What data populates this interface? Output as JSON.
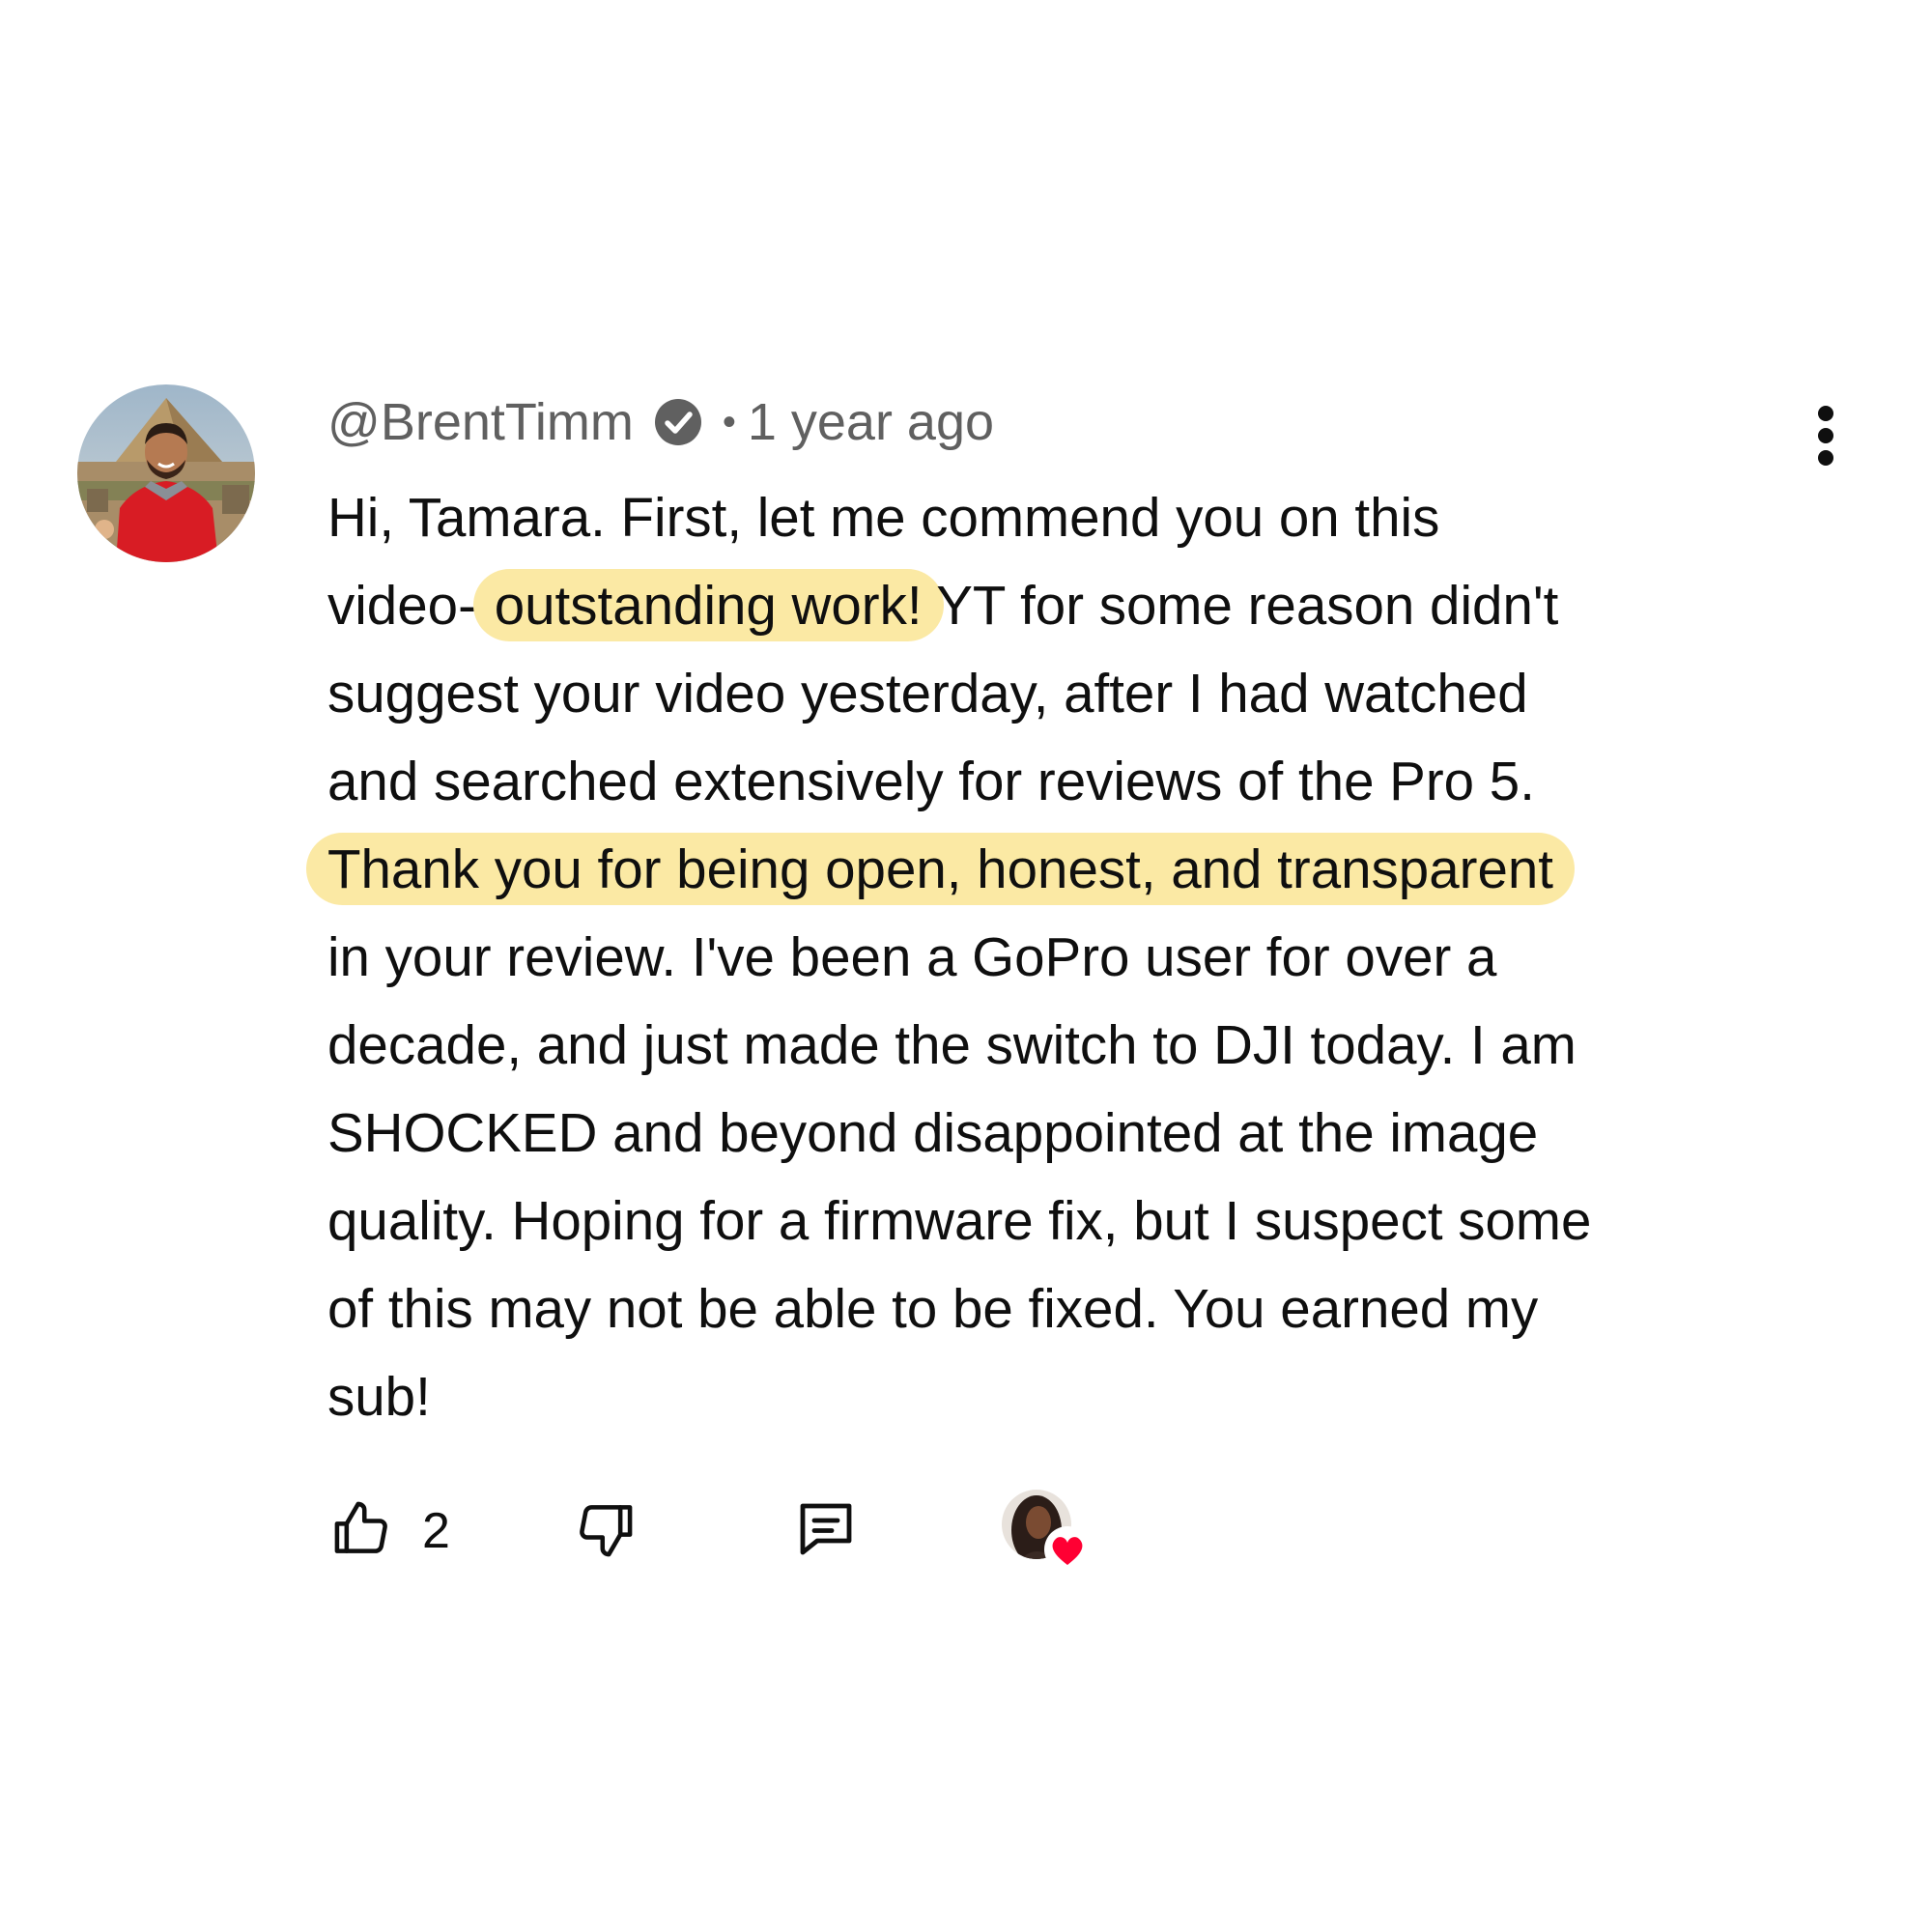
{
  "comment": {
    "author": "@BrentTimm",
    "separator": "•",
    "timestamp": "1 year ago",
    "lines": [
      {
        "segments": [
          {
            "text": "Hi, Tamara. First, let me commend you on this",
            "highlight": false
          }
        ]
      },
      {
        "segments": [
          {
            "text": "video--",
            "highlight": false
          },
          {
            "text": "outstanding work!",
            "highlight": true
          },
          {
            "text": " YT for some reason didn't",
            "highlight": false
          }
        ]
      },
      {
        "segments": [
          {
            "text": "suggest your video yesterday, after I had watched",
            "highlight": false
          }
        ]
      },
      {
        "segments": [
          {
            "text": "and searched extensively for reviews of the Pro 5.",
            "highlight": false
          }
        ]
      },
      {
        "segments": [
          {
            "text": "Thank you for being open, honest, and transparent",
            "highlight": true
          }
        ]
      },
      {
        "segments": [
          {
            "text": "in your review. I've been a GoPro user for over a",
            "highlight": false
          }
        ]
      },
      {
        "segments": [
          {
            "text": "decade, and just made the switch to DJI today. I am",
            "highlight": false
          }
        ]
      },
      {
        "segments": [
          {
            "text": "SHOCKED and beyond disappointed at the image",
            "highlight": false
          }
        ]
      },
      {
        "segments": [
          {
            "text": "quality. Hoping for a firmware fix, but I suspect some",
            "highlight": false
          }
        ]
      },
      {
        "segments": [
          {
            "text": "of this may not be able to be fixed. You earned my",
            "highlight": false
          }
        ]
      },
      {
        "segments": [
          {
            "text": "sub!",
            "highlight": false
          }
        ]
      }
    ],
    "like_count": "2"
  },
  "icons": {
    "verified": "verified-check-icon",
    "menu": "more-vertical-icon",
    "like": "thumbs-up-icon",
    "dislike": "thumbs-down-icon",
    "reply": "comment-reply-icon",
    "creator_heart": "heart-icon"
  },
  "colors": {
    "highlight": "#fbe9a4",
    "heart": "#ff0033",
    "meta_text": "#606060",
    "body_text": "#0f0f0f"
  }
}
